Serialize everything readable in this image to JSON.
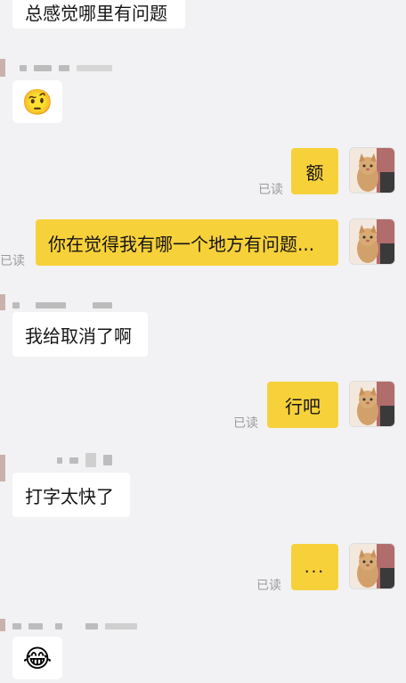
{
  "messages": [
    {
      "text": "总感觉哪里有问题"
    },
    {
      "emoji": "🤨"
    },
    {
      "text": "额",
      "read": "已读"
    },
    {
      "text": "你在觉得我有哪一个地方有问题...",
      "read": "已读"
    },
    {
      "text": "我给取消了啊"
    },
    {
      "text": "行吧",
      "read": "已读"
    },
    {
      "text": "打字太快了"
    },
    {
      "text": "...",
      "read": "已读"
    },
    {
      "emoji": "😂"
    }
  ],
  "icons": {
    "avatar": "cat-avatar-icon"
  },
  "colors": {
    "incoming_bubble": "#ffffff",
    "outgoing_bubble": "#f7d13a",
    "background": "#f2f2f4"
  }
}
